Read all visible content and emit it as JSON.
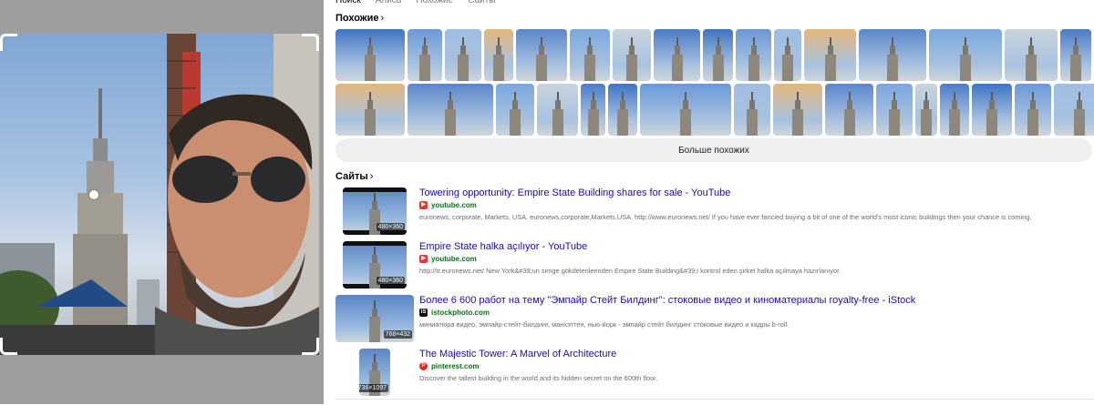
{
  "tabs": [
    "Поиск",
    "Алиса",
    "Похожие",
    "Сайты"
  ],
  "similar": {
    "title": "Похожие",
    "more_label": "Больше похожих"
  },
  "sites": {
    "title": "Сайты",
    "items": [
      {
        "title": "Towering opportunity: Empire State Building shares for sale - YouTube",
        "domain": "youtube.com",
        "favicon": "youtube-icon",
        "desc": "euronews, corporate, Markets, USA. euronews,corporate,Markets,USA. http://www.euronews.net/ If you have ever fancied buying a bit of one of the world's most iconic buildings then your chance is coming.",
        "dims": "480×360"
      },
      {
        "title": "Empire State halka açılıyor - YouTube",
        "domain": "youtube.com",
        "favicon": "youtube-icon",
        "desc": "http://tr.euronews.net/ New York&#39;un simge gökdelenlerinden Empire State Building&#39;i kontrol eden şirket halka açılmaya hazırlanıyor.",
        "dims": "480×360"
      },
      {
        "title": "Более 6 600 работ на тему \"Эмпайр Стейт Билдинг\": стоковые видео и киноматериалы royalty-free - iStock",
        "domain": "istockphoto.com",
        "favicon": "istock-icon",
        "desc": "миниатюра видео, эмпайр-стейт-билдинг, манхэттен, нью-йорк - эмпайр стейт билдинг стоковые видео и кадры b-roll.",
        "dims": "768×432"
      },
      {
        "title": "The Majestic Tower: A Marvel of Architecture",
        "domain": "pinterest.com",
        "favicon": "pinterest-icon",
        "desc": "Discover the tallest building in the world and its hidden secret on the 600th floor.",
        "dims": "736×1097"
      }
    ]
  },
  "colors": {
    "link": "#1a0dab",
    "domain": "#0b6f1b",
    "pane_bg": "#9e9e9e"
  }
}
